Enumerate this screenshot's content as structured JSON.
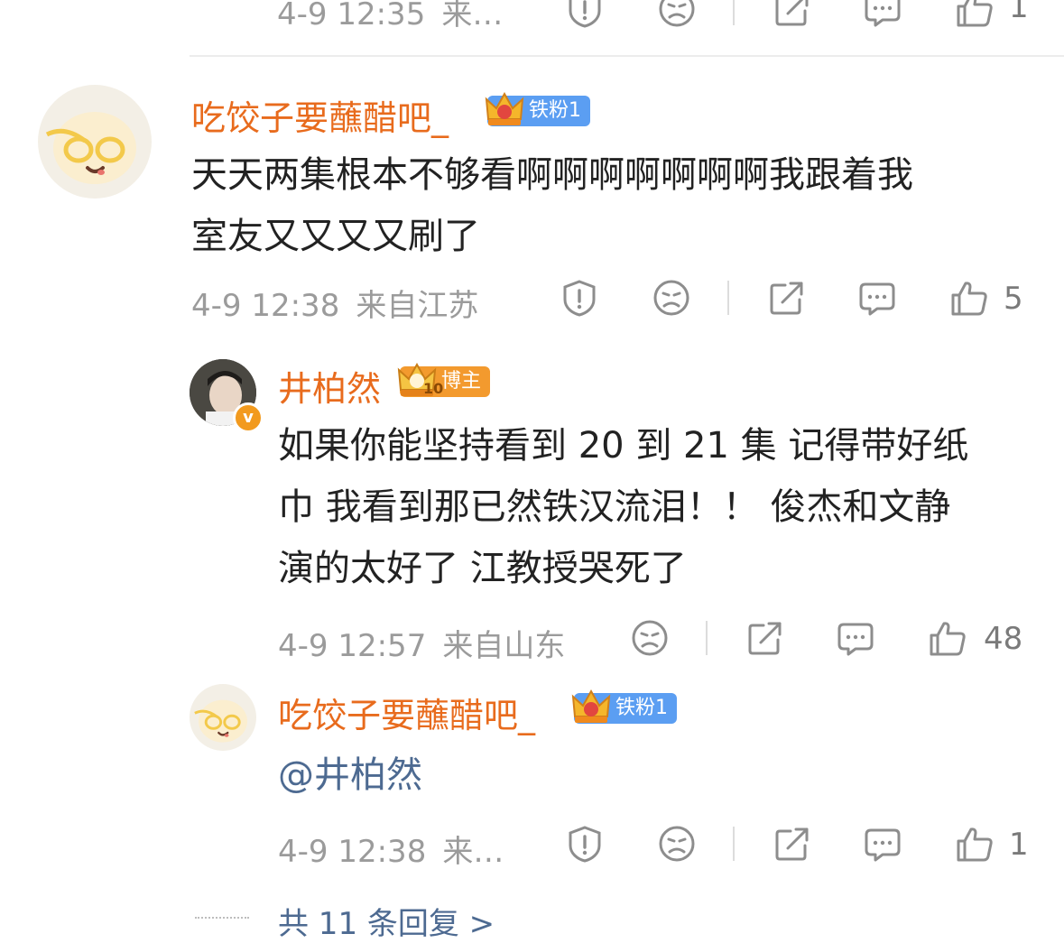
{
  "colors": {
    "name_orange": "#e86b1d",
    "meta_gray": "#9b9b9b",
    "badge_blue": "#5b9ef2",
    "badge_orange": "#f39a2e",
    "mention_blue": "#4d6a91"
  },
  "top_row": {
    "time": "4-9 12:35",
    "location": "来…",
    "like_count": "1",
    "icons": [
      "report-icon",
      "dislike-face-icon",
      "share-icon",
      "comment-icon",
      "thumbs-up-icon"
    ]
  },
  "comment1": {
    "user": "吃饺子要蘸醋吧_",
    "badge": "铁粉1",
    "text_line1": "天天两集根本不够看啊啊啊啊啊啊啊我跟着我",
    "text_line2": "室友又又又又刷了",
    "time": "4-9 12:38",
    "location": "来自江苏",
    "like_count": "5"
  },
  "reply1": {
    "user": "井柏然",
    "badge": "博主",
    "crown_level": "10",
    "text_line1": "如果你能坚持看到 20 到 21 集  记得带好纸",
    "text_line2": "巾  我看到那已然铁汉流泪！！  俊杰和文静",
    "text_line3": "演的太好了  江教授哭死了",
    "time": "4-9 12:57",
    "location": "来自山东",
    "like_count": "48"
  },
  "reply2": {
    "user": "吃饺子要蘸醋吧_",
    "badge": "铁粉1",
    "text": "@井柏然",
    "time": "4-9 12:38",
    "location": "来…",
    "like_count": "1"
  },
  "more_replies": "共 11 条回复 >"
}
